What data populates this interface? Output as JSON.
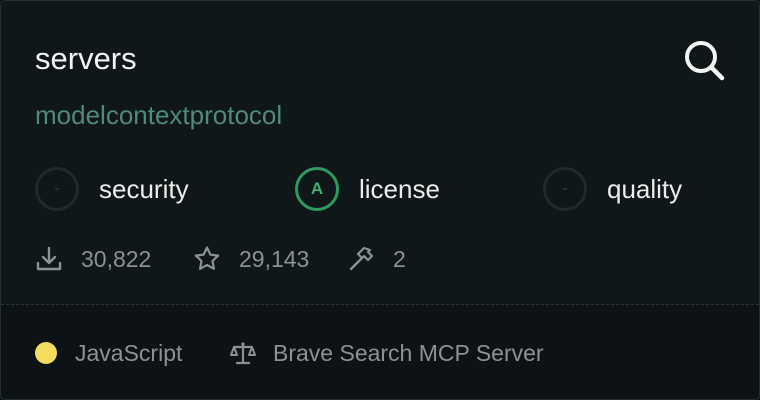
{
  "repo": {
    "name": "servers",
    "owner": "modelcontextprotocol"
  },
  "scores": [
    {
      "grade": "-",
      "label": "security"
    },
    {
      "grade": "A",
      "label": "license"
    },
    {
      "grade": "-",
      "label": "quality"
    }
  ],
  "stats": {
    "downloads": "30,822",
    "stars": "29,143",
    "tools": "2"
  },
  "footer": {
    "language": "JavaScript",
    "language_color": "#f2de5c",
    "description": "Brave Search MCP Server"
  },
  "colors": {
    "background": "#101718",
    "owner": "#4f8a7a",
    "grade_a": "#2e9a60"
  },
  "icons": {
    "search": "search-icon",
    "downloads": "download-icon",
    "stars": "star-icon",
    "tools": "hammer-icon",
    "license": "scale-icon"
  }
}
